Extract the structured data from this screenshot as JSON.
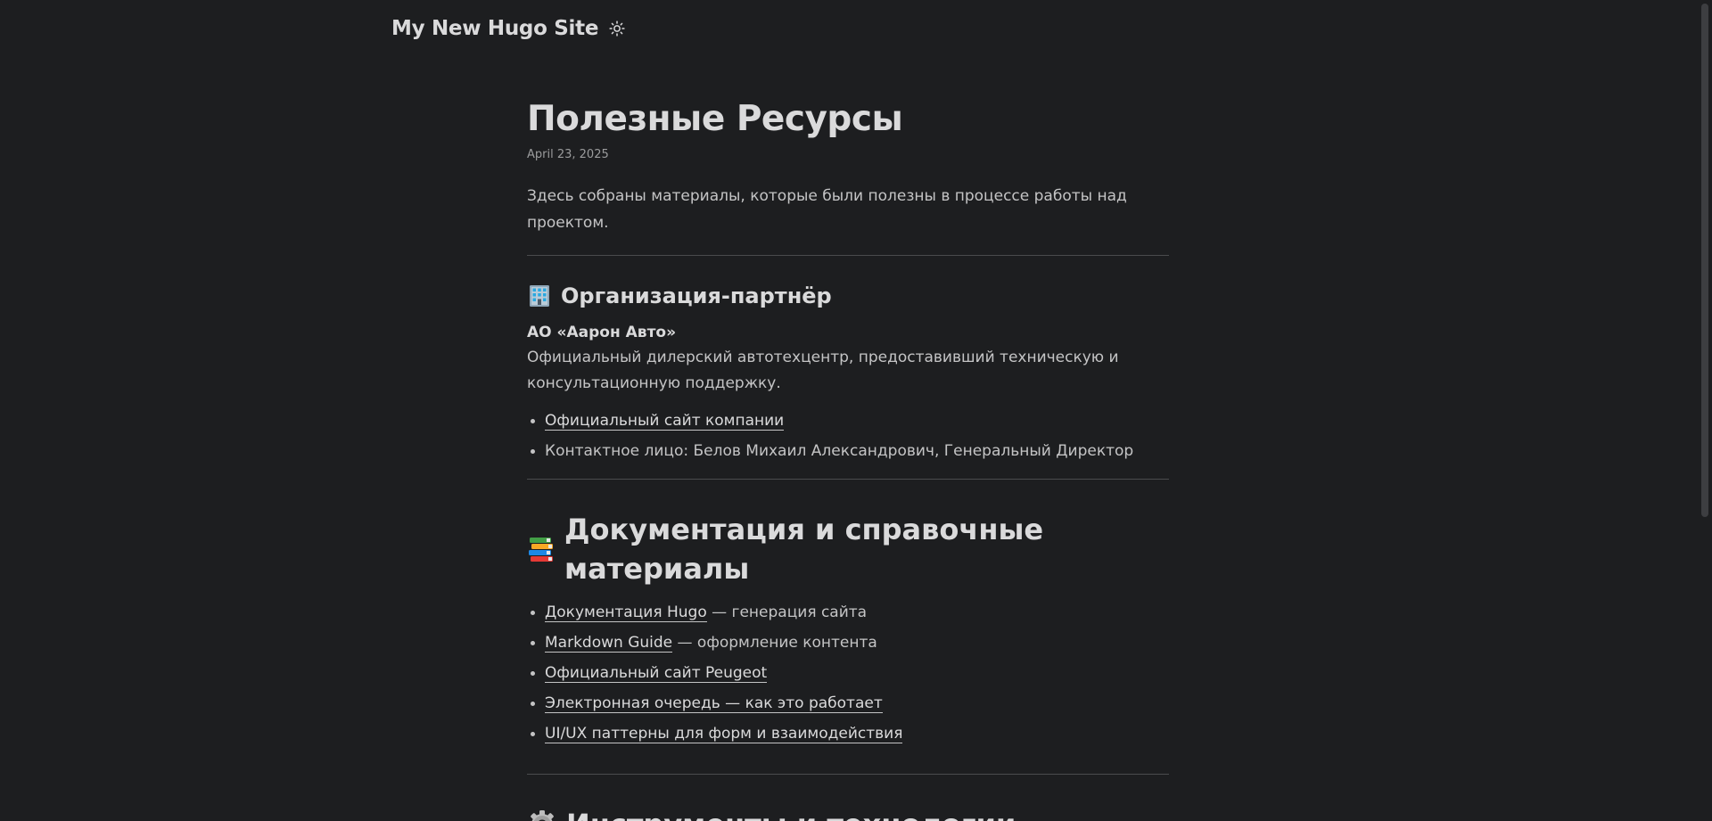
{
  "header": {
    "site_title": "My New Hugo Site",
    "theme_toggle_icon": "sun-icon"
  },
  "post": {
    "title": "Полезные Ресурсы",
    "date": "April 23, 2025",
    "intro": "Здесь собраны материалы, которые были полезны в процессе работы над проектом."
  },
  "sections": {
    "partner": {
      "icon": "office-building-icon",
      "heading": "Организация-партнёр",
      "org_name": "АО «Аарон Авто»",
      "org_desc_line1": "Официальный дилерский автотехцентр, предоставивший техническую и",
      "org_desc_line2": "консультационную поддержку.",
      "items": {
        "site_link": "Официальный сайт компании",
        "contact": "Контактное лицо: Белов Михаил Александрович, Генеральный Директор"
      }
    },
    "docs": {
      "icon": "books-icon",
      "heading": "Документация и справочные материалы",
      "items": [
        {
          "link": "Документация Hugo",
          "suffix": " — генерация сайта"
        },
        {
          "link": "Markdown Guide",
          "suffix": " — оформление контента"
        },
        {
          "link": "Официальный сайт Peugeot",
          "suffix": ""
        },
        {
          "link": "Электронная очередь — как это работает",
          "suffix": ""
        },
        {
          "link": "UI/UX паттерны для форм и взаимодействия",
          "suffix": ""
        }
      ]
    },
    "tools": {
      "icon": "gear-icon",
      "heading": "Инструменты и технологии"
    }
  },
  "colors": {
    "background": "#1d1e20",
    "text": "#dadadb",
    "secondary_text": "#9b9c9d",
    "divider": "#4a4b4d"
  }
}
